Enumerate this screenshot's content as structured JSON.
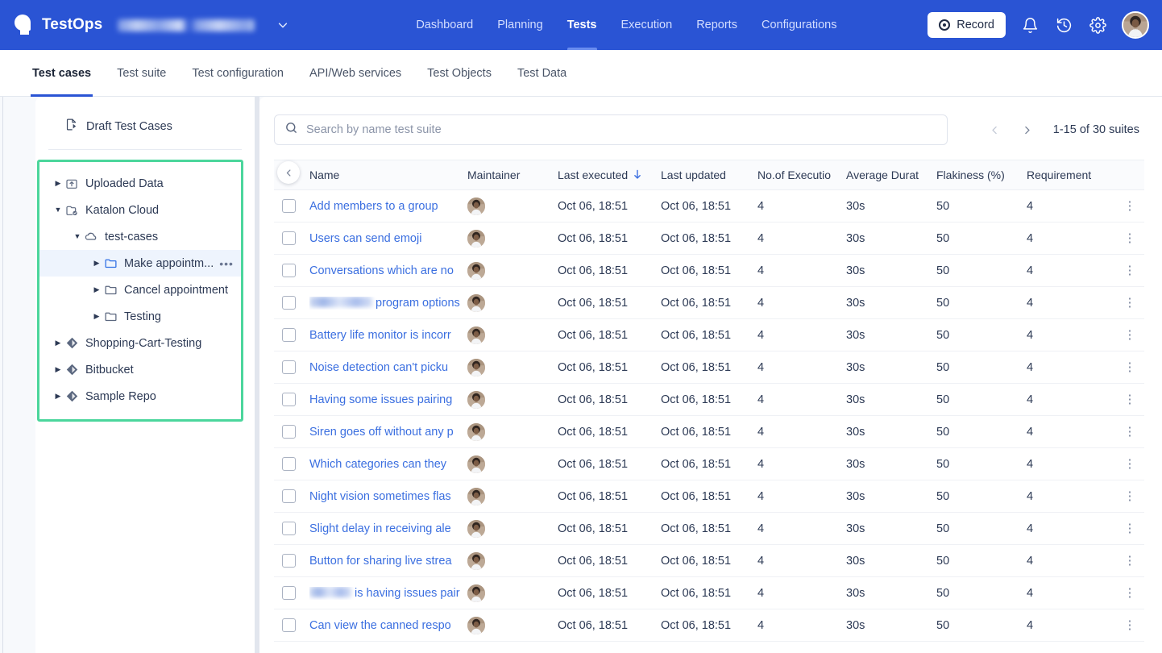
{
  "topnav": {
    "brand": "TestOps",
    "brand_redacted": true,
    "project_caret_icon": "chevron-down-icon",
    "links": [
      {
        "label": "Dashboard",
        "active": false
      },
      {
        "label": "Planning",
        "active": false
      },
      {
        "label": "Tests",
        "active": true
      },
      {
        "label": "Execution",
        "active": false
      },
      {
        "label": "Reports",
        "active": false
      },
      {
        "label": "Configurations",
        "active": false
      }
    ],
    "record_label": "Record",
    "record_icon": "record-circle-icon",
    "actions": [
      {
        "name": "notifications-icon"
      },
      {
        "name": "history-icon"
      },
      {
        "name": "settings-gear-icon"
      }
    ],
    "avatar": "user-avatar",
    "bg_color": "#2A54D4"
  },
  "subtabs": [
    {
      "label": "Test cases",
      "active": true
    },
    {
      "label": "Test suite",
      "active": false
    },
    {
      "label": "Test configuration",
      "active": false
    },
    {
      "label": "API/Web services",
      "active": false
    },
    {
      "label": "Test Objects",
      "active": false
    },
    {
      "label": "Test Data",
      "active": false
    }
  ],
  "sidebar": {
    "draft_label": "Draft Test Cases",
    "draft_icon": "draft-file-icon",
    "collapse_icon": "chevron-left-icon",
    "highlight_color": "#4BD69C",
    "tree": [
      {
        "label": "Uploaded Data",
        "level": 0,
        "icon": "upload-folder-icon",
        "expanded": false,
        "selected": false,
        "menu": false
      },
      {
        "label": "Katalon Cloud",
        "level": 0,
        "icon": "cloud-repo-icon",
        "expanded": true,
        "selected": false,
        "menu": false
      },
      {
        "label": "test-cases",
        "level": 1,
        "icon": "cloud-icon",
        "expanded": true,
        "selected": false,
        "menu": false
      },
      {
        "label": "Make appointm...",
        "level": 2,
        "icon": "folder-icon-blue",
        "expanded": false,
        "selected": true,
        "menu": true,
        "menu_label": "•••"
      },
      {
        "label": "Cancel appointment",
        "level": 2,
        "icon": "folder-icon",
        "expanded": false,
        "selected": false,
        "menu": false
      },
      {
        "label": "Testing",
        "level": 2,
        "icon": "folder-icon",
        "expanded": false,
        "selected": false,
        "menu": false
      },
      {
        "label": "Shopping-Cart-Testing",
        "level": 0,
        "icon": "git-repo-icon",
        "expanded": false,
        "selected": false,
        "menu": false
      },
      {
        "label": "Bitbucket",
        "level": 0,
        "icon": "git-repo-icon",
        "expanded": false,
        "selected": false,
        "menu": false
      },
      {
        "label": "Sample Repo",
        "level": 0,
        "icon": "git-repo-icon",
        "expanded": false,
        "selected": false,
        "menu": false
      }
    ]
  },
  "main": {
    "search": {
      "placeholder": "Search by name test suite",
      "value": "",
      "icon": "search-icon"
    },
    "pagination": {
      "prev_icon": "chevron-left-icon",
      "next_icon": "chevron-right-icon",
      "label": "1-15 of 30 suites"
    },
    "table": {
      "columns": [
        {
          "key": "name",
          "label": "Name"
        },
        {
          "key": "maint",
          "label": "Maintainer"
        },
        {
          "key": "lexe",
          "label": "Last executed",
          "sorted": true,
          "sort_icon": "sort-down-arrow-icon"
        },
        {
          "key": "lupd",
          "label": "Last updated"
        },
        {
          "key": "nexe",
          "label": "No.of Executio"
        },
        {
          "key": "avg",
          "label": "Average Durat"
        },
        {
          "key": "flak",
          "label": "Flakiness (%)"
        },
        {
          "key": "req",
          "label": "Requirement"
        }
      ],
      "rows": [
        {
          "name": "Add members to a group",
          "redacted_prefix": false,
          "maintainer": "user-avatar",
          "last_executed": "Oct 06, 18:51",
          "last_updated": "Oct 06, 18:51",
          "executions": "4",
          "avg_duration": "30s",
          "flakiness": "50",
          "requirement": "4"
        },
        {
          "name": "Users can send emoji",
          "redacted_prefix": false,
          "maintainer": "user-avatar",
          "last_executed": "Oct 06, 18:51",
          "last_updated": "Oct 06, 18:51",
          "executions": "4",
          "avg_duration": "30s",
          "flakiness": "50",
          "requirement": "4"
        },
        {
          "name": "Conversations which are no",
          "redacted_prefix": false,
          "maintainer": "user-avatar",
          "last_executed": "Oct 06, 18:51",
          "last_updated": "Oct 06, 18:51",
          "executions": "4",
          "avg_duration": "30s",
          "flakiness": "50",
          "requirement": "4"
        },
        {
          "name": "program options",
          "redacted_prefix": true,
          "maintainer": "user-avatar",
          "last_executed": "Oct 06, 18:51",
          "last_updated": "Oct 06, 18:51",
          "executions": "4",
          "avg_duration": "30s",
          "flakiness": "50",
          "requirement": "4"
        },
        {
          "name": "Battery life monitor is incorr",
          "redacted_prefix": false,
          "maintainer": "user-avatar",
          "last_executed": "Oct 06, 18:51",
          "last_updated": "Oct 06, 18:51",
          "executions": "4",
          "avg_duration": "30s",
          "flakiness": "50",
          "requirement": "4"
        },
        {
          "name": "Noise detection can't picku",
          "redacted_prefix": false,
          "maintainer": "user-avatar",
          "last_executed": "Oct 06, 18:51",
          "last_updated": "Oct 06, 18:51",
          "executions": "4",
          "avg_duration": "30s",
          "flakiness": "50",
          "requirement": "4"
        },
        {
          "name": "Having some issues pairing",
          "redacted_prefix": false,
          "maintainer": "user-avatar",
          "last_executed": "Oct 06, 18:51",
          "last_updated": "Oct 06, 18:51",
          "executions": "4",
          "avg_duration": "30s",
          "flakiness": "50",
          "requirement": "4"
        },
        {
          "name": "Siren goes off without any p",
          "redacted_prefix": false,
          "maintainer": "user-avatar",
          "last_executed": "Oct 06, 18:51",
          "last_updated": "Oct 06, 18:51",
          "executions": "4",
          "avg_duration": "30s",
          "flakiness": "50",
          "requirement": "4"
        },
        {
          "name": "Which categories can they",
          "redacted_prefix": false,
          "maintainer": "user-avatar",
          "last_executed": "Oct 06, 18:51",
          "last_updated": "Oct 06, 18:51",
          "executions": "4",
          "avg_duration": "30s",
          "flakiness": "50",
          "requirement": "4"
        },
        {
          "name": "Night vision sometimes flas",
          "redacted_prefix": false,
          "maintainer": "user-avatar",
          "last_executed": "Oct 06, 18:51",
          "last_updated": "Oct 06, 18:51",
          "executions": "4",
          "avg_duration": "30s",
          "flakiness": "50",
          "requirement": "4"
        },
        {
          "name": "Slight delay in receiving ale",
          "redacted_prefix": false,
          "maintainer": "user-avatar",
          "last_executed": "Oct 06, 18:51",
          "last_updated": "Oct 06, 18:51",
          "executions": "4",
          "avg_duration": "30s",
          "flakiness": "50",
          "requirement": "4"
        },
        {
          "name": "Button for sharing live strea",
          "redacted_prefix": false,
          "maintainer": "user-avatar",
          "last_executed": "Oct 06, 18:51",
          "last_updated": "Oct 06, 18:51",
          "executions": "4",
          "avg_duration": "30s",
          "flakiness": "50",
          "requirement": "4"
        },
        {
          "name": "is having issues pair",
          "redacted_prefix": true,
          "maintainer": "user-avatar",
          "last_executed": "Oct 06, 18:51",
          "last_updated": "Oct 06, 18:51",
          "executions": "4",
          "avg_duration": "30s",
          "flakiness": "50",
          "requirement": "4"
        },
        {
          "name": "Can view the canned respo",
          "redacted_prefix": false,
          "maintainer": "user-avatar",
          "last_executed": "Oct 06, 18:51",
          "last_updated": "Oct 06, 18:51",
          "executions": "4",
          "avg_duration": "30s",
          "flakiness": "50",
          "requirement": "4"
        }
      ],
      "row_menu_icon": "kebab-menu-icon",
      "select_all_icon": "checkbox-unchecked"
    }
  }
}
